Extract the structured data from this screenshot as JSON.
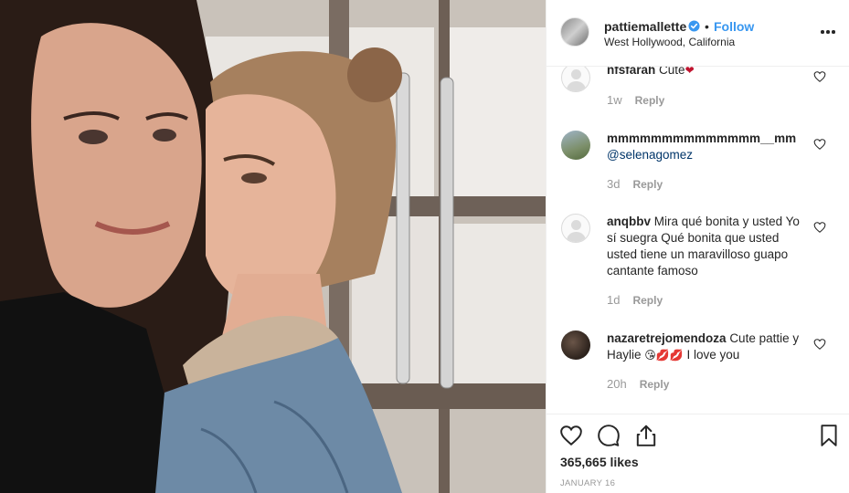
{
  "post": {
    "username": "pattiemallette",
    "dot": "•",
    "follow_label": "Follow",
    "location": "West Hollywood, California",
    "more_icon": "more-options-icon"
  },
  "comments": [
    {
      "user": "nfsfarah",
      "text": "Cute",
      "emoji": "❤",
      "age": "1w",
      "reply": "Reply",
      "avatar": "default"
    },
    {
      "user": "mmmmmmmmmmmmmm__mm",
      "mention": "@selenagomez",
      "age": "3d",
      "reply": "Reply",
      "avatar": "photo"
    },
    {
      "user": "anqbbv",
      "text": "Mira qué bonita y usted Yo sí suegra Qué bonita que usted usted tiene un maravilloso guapo cantante famoso",
      "age": "1d",
      "reply": "Reply",
      "avatar": "default"
    },
    {
      "user": "nazaretrejomendoza",
      "text": "Cute pattie y Haylie",
      "emoji": "😘💋💋",
      "text2": "I love you",
      "age": "20h",
      "reply": "Reply",
      "avatar": "photo"
    }
  ],
  "actions": {
    "likes": "365,665 likes",
    "date": "JANUARY 16"
  },
  "colors": {
    "accent": "#3897f0",
    "text": "#262626",
    "muted": "#999999",
    "border": "#efefef",
    "heart_emoji": "#c0142f"
  }
}
